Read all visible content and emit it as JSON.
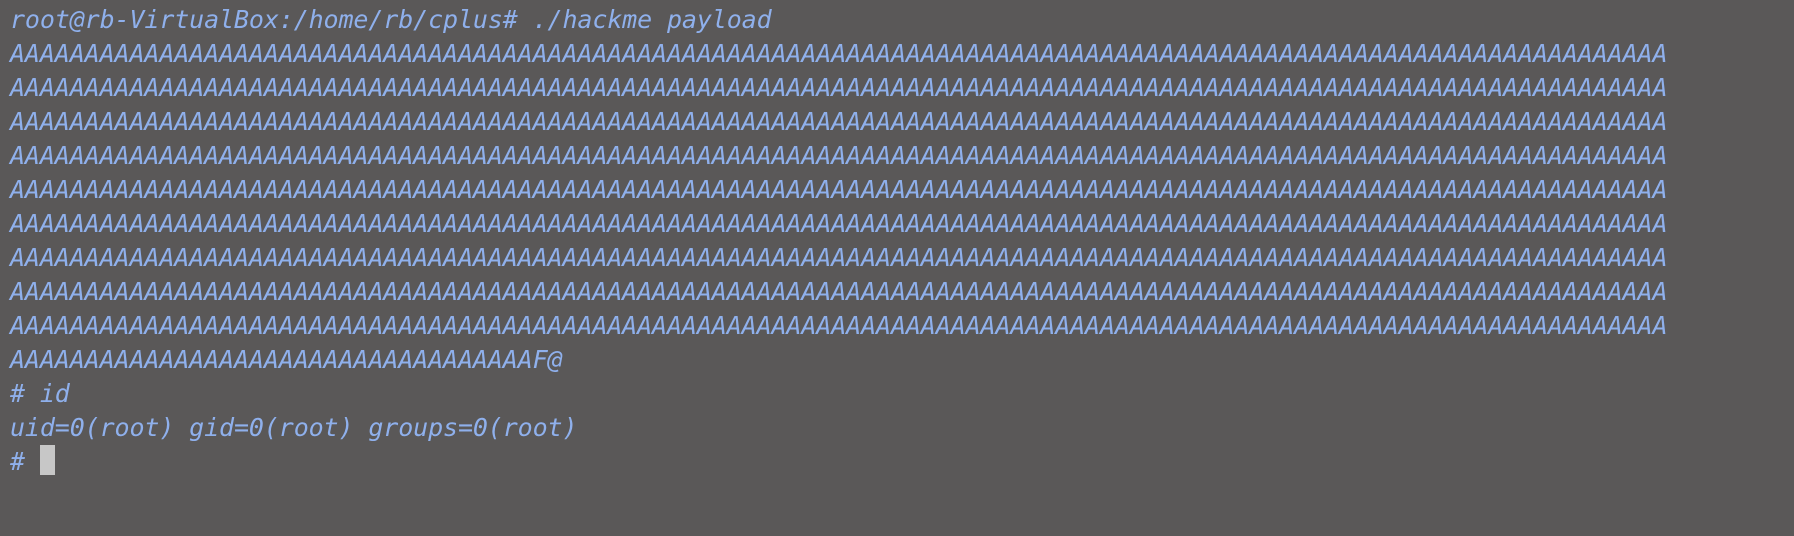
{
  "terminal": {
    "lines": [
      "root@rb-VirtualBox:/home/rb/cplus# ./hackme payload",
      "AAAAAAAAAAAAAAAAAAAAAAAAAAAAAAAAAAAAAAAAAAAAAAAAAAAAAAAAAAAAAAAAAAAAAAAAAAAAAAAAAAAAAAAAAAAAAAAAAAAAAAAAAAAAAAA",
      "AAAAAAAAAAAAAAAAAAAAAAAAAAAAAAAAAAAAAAAAAAAAAAAAAAAAAAAAAAAAAAAAAAAAAAAAAAAAAAAAAAAAAAAAAAAAAAAAAAAAAAAAAAAAAAA",
      "AAAAAAAAAAAAAAAAAAAAAAAAAAAAAAAAAAAAAAAAAAAAAAAAAAAAAAAAAAAAAAAAAAAAAAAAAAAAAAAAAAAAAAAAAAAAAAAAAAAAAAAAAAAAAAA",
      "AAAAAAAAAAAAAAAAAAAAAAAAAAAAAAAAAAAAAAAAAAAAAAAAAAAAAAAAAAAAAAAAAAAAAAAAAAAAAAAAAAAAAAAAAAAAAAAAAAAAAAAAAAAAAAA",
      "AAAAAAAAAAAAAAAAAAAAAAAAAAAAAAAAAAAAAAAAAAAAAAAAAAAAAAAAAAAAAAAAAAAAAAAAAAAAAAAAAAAAAAAAAAAAAAAAAAAAAAAAAAAAAAA",
      "AAAAAAAAAAAAAAAAAAAAAAAAAAAAAAAAAAAAAAAAAAAAAAAAAAAAAAAAAAAAAAAAAAAAAAAAAAAAAAAAAAAAAAAAAAAAAAAAAAAAAAAAAAAAAAA",
      "AAAAAAAAAAAAAAAAAAAAAAAAAAAAAAAAAAAAAAAAAAAAAAAAAAAAAAAAAAAAAAAAAAAAAAAAAAAAAAAAAAAAAAAAAAAAAAAAAAAAAAAAAAAAAAA",
      "AAAAAAAAAAAAAAAAAAAAAAAAAAAAAAAAAAAAAAAAAAAAAAAAAAAAAAAAAAAAAAAAAAAAAAAAAAAAAAAAAAAAAAAAAAAAAAAAAAAAAAAAAAAAAAA",
      "AAAAAAAAAAAAAAAAAAAAAAAAAAAAAAAAAAAAAAAAAAAAAAAAAAAAAAAAAAAAAAAAAAAAAAAAAAAAAAAAAAAAAAAAAAAAAAAAAAAAAAAAAAAAAAA",
      "AAAAAAAAAAAAAAAAAAAAAAAAAAAAAAAAAAAF@",
      "# id",
      "uid=0(root) gid=0(root) groups=0(root)"
    ],
    "prompt": "# ",
    "colors": {
      "background": "#5a5858",
      "text": "#8fb0ec",
      "cursor": "#c7c7c7"
    }
  }
}
